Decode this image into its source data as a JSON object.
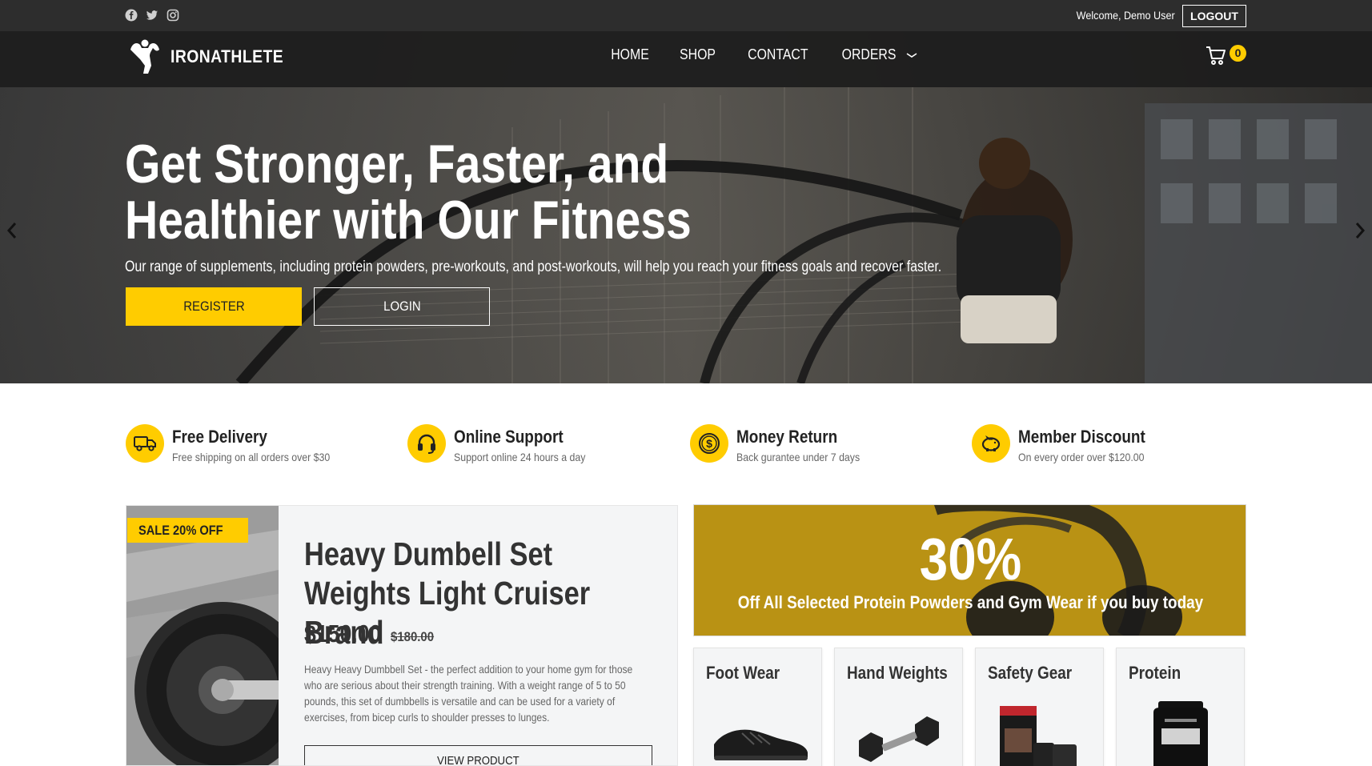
{
  "topbar": {
    "social_icons": [
      "facebook-icon",
      "twitter-icon",
      "instagram-icon"
    ],
    "welcome": "Welcome, Demo User",
    "logout": "LOGOUT"
  },
  "brand": {
    "name": "IRONATHLETE"
  },
  "nav": {
    "items": [
      {
        "label": "HOME"
      },
      {
        "label": "SHOP"
      },
      {
        "label": "CONTACT"
      },
      {
        "label": "ORDERS"
      }
    ],
    "cart_count": "0"
  },
  "hero": {
    "title": "Get Stronger, Faster, and Healthier with Our Fitness",
    "subtitle": "Our range of supplements, including protein powders, pre-workouts, and post-workouts, will help you reach your fitness goals and recover faster.",
    "register": "REGISTER",
    "login": "LOGIN"
  },
  "features": [
    {
      "icon": "truck-icon",
      "title": "Free Delivery",
      "subtitle": "Free shipping on all orders over $30"
    },
    {
      "icon": "headset-icon",
      "title": "Online Support",
      "subtitle": "Support online 24 hours a day"
    },
    {
      "icon": "dollar-icon",
      "title": "Money Return",
      "subtitle": "Back gurantee under 7 days"
    },
    {
      "icon": "piggy-bank-icon",
      "title": "Member Discount",
      "subtitle": "On every order over $120.00"
    }
  ],
  "featured_product": {
    "badge": "SALE 20% OFF",
    "title": "Heavy Dumbell Set Weights Light Cruiser Brand",
    "price": "$150.00",
    "old_price": "$180.00",
    "description": "Heavy Heavy Dumbbell Set - the perfect addition to your home gym for those who are serious about their strength training. With a weight range of 5 to 50 pounds, this set of dumbbells is versatile and can be used for a variety of exercises, from bicep curls to shoulder presses to lunges.",
    "button": "VIEW PRODUCT"
  },
  "promo": {
    "big": "30%",
    "sub": "Off All Selected Protein Powders and Gym Wear if you buy today"
  },
  "categories": [
    {
      "title": "Foot Wear"
    },
    {
      "title": "Hand Weights"
    },
    {
      "title": "Safety Gear"
    },
    {
      "title": "Protein"
    }
  ],
  "colors": {
    "accent": "#ffcc00",
    "topbar": "#2d2d2d",
    "promo": "#b9920b"
  }
}
